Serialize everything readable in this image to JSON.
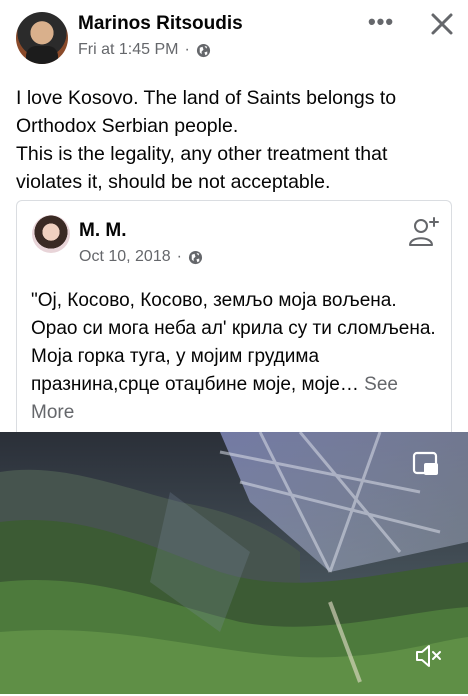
{
  "post": {
    "author": "Marinos Ritsoudis",
    "timestamp": "Fri at 1:45 PM",
    "separator": "·",
    "privacy_icon": "globe-icon",
    "more_icon": "more-dots-icon",
    "more_label": "•••",
    "close_icon": "close-icon",
    "text_lines": [
      "I love Kosovo. The land of Saints belongs to Orthodox Serbian people.",
      "This is the legality, any other treatment that violates it, should be not acceptable."
    ]
  },
  "shared": {
    "author": "M. M.",
    "timestamp": "Oct 10, 2018",
    "separator": "·",
    "privacy_icon": "globe-icon",
    "add_friend_icon": "add-friend-icon",
    "text": "\"Ој, Косово, Косово, земљо моја вољена. Орао си мога неба ал' крила су ти сломљена. Моја горка туга, у мојим грудима празнина,срце отаџбине моје, моје…",
    "see_more": "See More"
  },
  "video": {
    "pip_icon": "picture-in-picture-icon",
    "mute_icon": "muted-speaker-icon"
  },
  "colors": {
    "text": "#050505",
    "secondary": "#65676b",
    "border": "#dadde1"
  }
}
